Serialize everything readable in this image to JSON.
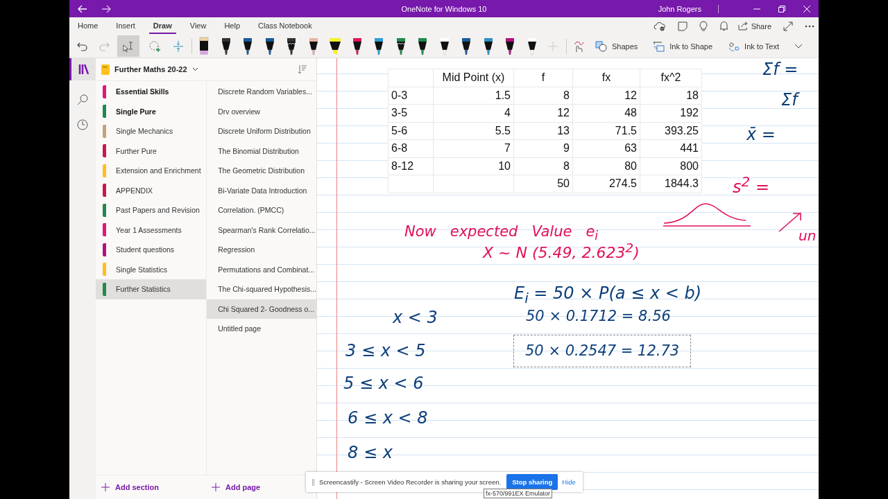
{
  "window": {
    "title": "OneNote for Windows 10",
    "user": "John Rogers"
  },
  "ribbon": {
    "tabs": [
      {
        "label": "Home",
        "selected": false
      },
      {
        "label": "Insert",
        "selected": false
      },
      {
        "label": "Draw",
        "selected": true
      },
      {
        "label": "View",
        "selected": false
      },
      {
        "label": "Help",
        "selected": false
      },
      {
        "label": "Class Notebook",
        "selected": false
      }
    ],
    "share": "Share",
    "pens": [
      {
        "kind": "pencil",
        "color": "#d9a8e0"
      },
      {
        "kind": "pen",
        "color": "#333333"
      },
      {
        "kind": "pen",
        "color": "#1a5a9a"
      },
      {
        "kind": "pen",
        "color": "#1a5a9a"
      },
      {
        "kind": "glitter",
        "color": "#333333"
      },
      {
        "kind": "pen",
        "color": "#e8b4a4"
      },
      {
        "kind": "highlighter",
        "color": "#f5f02a"
      },
      {
        "kind": "pen",
        "color": "#e0175a"
      },
      {
        "kind": "pen",
        "color": "#2e9fd8"
      },
      {
        "kind": "glitter",
        "color": "#1f8a4c"
      },
      {
        "kind": "pen",
        "color": "#1f8a4c"
      },
      {
        "kind": "pen",
        "color": "#ffffff"
      },
      {
        "kind": "pen",
        "color": "#1a5a9a"
      },
      {
        "kind": "pen",
        "color": "#2e8fc0"
      },
      {
        "kind": "pen",
        "color": "#b0147f"
      },
      {
        "kind": "pen",
        "color": "#ffffff"
      }
    ],
    "tools": [
      "Shapes",
      "Ink to Shape",
      "Ink to Text"
    ]
  },
  "notebook": {
    "name": "Further Maths 20-22"
  },
  "sections": [
    {
      "label": "Essential Skills",
      "color": "#e0177a",
      "unread": true,
      "selected": false
    },
    {
      "label": "Single Pure",
      "color": "#1f8a4c",
      "unread": true,
      "selected": false
    },
    {
      "label": "Single Mechanics",
      "color": "#c4a27a",
      "unread": false,
      "selected": false
    },
    {
      "label": "Further Pure",
      "color": "#c8184f",
      "unread": false,
      "selected": false
    },
    {
      "label": "Extension and Enrichment",
      "color": "#ffbf1a",
      "unread": false,
      "selected": false
    },
    {
      "label": "APPENDIX",
      "color": "#c8184f",
      "unread": false,
      "selected": false
    },
    {
      "label": "Past Papers and Revision",
      "color": "#1f8a4c",
      "unread": false,
      "selected": false
    },
    {
      "label": "Year 1 Assessments",
      "color": "#e0177a",
      "unread": false,
      "selected": false
    },
    {
      "label": "Student questions",
      "color": "#b0147f",
      "unread": false,
      "selected": false
    },
    {
      "label": "Single Statistics",
      "color": "#ffbf1a",
      "unread": false,
      "selected": false
    },
    {
      "label": "Further Statistics",
      "color": "#1f8a4c",
      "unread": false,
      "selected": true
    }
  ],
  "pages": [
    {
      "label": "Discrete Random Variables...",
      "selected": false
    },
    {
      "label": "Drv overview",
      "selected": false
    },
    {
      "label": "Discrete Uniform Distribution",
      "selected": false
    },
    {
      "label": "The Binomial Distribution",
      "selected": false
    },
    {
      "label": "The Geometric Distribution",
      "selected": false
    },
    {
      "label": "Bi-Variate Data Introduction",
      "selected": false
    },
    {
      "label": "Correlation. (PMCC)",
      "selected": false
    },
    {
      "label": "Spearman's Rank Correlatio...",
      "selected": false
    },
    {
      "label": "Regression",
      "selected": false
    },
    {
      "label": "Permutations and Combinat...",
      "selected": false
    },
    {
      "label": "The Chi-squared Hypothesis...",
      "selected": false
    },
    {
      "label": "Chi Squared 2- Goodness o...",
      "selected": true
    },
    {
      "label": "Untitled page",
      "selected": false
    }
  ],
  "add_section": "Add section",
  "add_page": "Add page",
  "table": {
    "columns": [
      "",
      "Mid Point (x)",
      "f",
      "fx",
      "fx^2"
    ],
    "rows": [
      [
        "0-3",
        "1.5",
        "8",
        "12",
        "18"
      ],
      [
        "3-5",
        "4",
        "12",
        "48",
        "192"
      ],
      [
        "5-6",
        "5.5",
        "13",
        "71.5",
        "393.25"
      ],
      [
        "6-8",
        "7",
        "9",
        "63",
        "441"
      ],
      [
        "8-12",
        "10",
        "8",
        "80",
        "800"
      ],
      [
        "",
        "",
        "50",
        "274.5",
        "1844.3"
      ]
    ]
  },
  "ink": [
    {
      "text": "Σf =",
      "color": "#0d3f7a",
      "selected": false
    },
    {
      "text": "Σf",
      "color": "#0d3f7a",
      "selected": false
    },
    {
      "text": "x̄ =",
      "color": "#0d3f7a",
      "selected": false
    },
    {
      "text": "s$^{2}$ =",
      "color": "#e0105a",
      "selected": false
    },
    {
      "text": "Now   expected   Value   e$_{i}$",
      "color": "#e0105a",
      "selected": false
    },
    {
      "text": "un",
      "color": "#e0105a",
      "selected": false
    },
    {
      "text": "X ~ N (5.49, 2.623$^{2}$)",
      "color": "#e0105a",
      "selected": false
    },
    {
      "text": "E$_{i}$ = 50 × P(a ≤ x < b)",
      "color": "#0d3f7a",
      "selected": false
    },
    {
      "text": "x < 3",
      "color": "#0d3f7a",
      "selected": false
    },
    {
      "text": "50 × 0.1712 = 8.56",
      "color": "#0d3f7a",
      "selected": false
    },
    {
      "text": "3 ≤ x < 5",
      "color": "#0d3f7a",
      "selected": false
    },
    {
      "text": "50 × 0.2547 = 12.73",
      "color": "#0d3f7a",
      "selected": true
    },
    {
      "text": "5 ≤ x < 6",
      "color": "#0d3f7a",
      "selected": false
    },
    {
      "text": "6 ≤ x < 8",
      "color": "#0d3f7a",
      "selected": false
    },
    {
      "text": "8 ≤ x",
      "color": "#0d3f7a",
      "selected": false
    }
  ],
  "notification": {
    "text": "Screencastify - Screen Video Recorder is sharing your screen.",
    "stop": "Stop sharing",
    "hide": "Hide"
  },
  "tooltip": "fx-570/991EX Emulator"
}
